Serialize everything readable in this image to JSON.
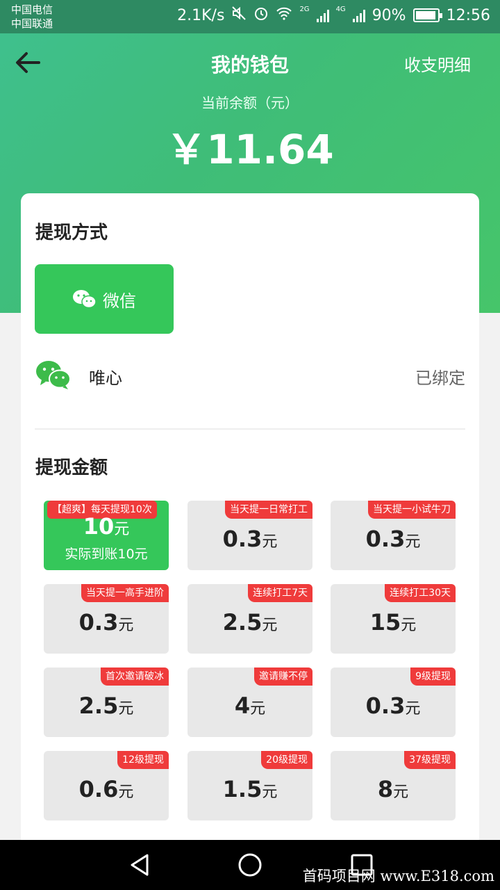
{
  "status_bar": {
    "carrier1": "中国电信",
    "carrier2": "中国联通",
    "speed": "2.1K/s",
    "net1": "2G",
    "net2": "4G",
    "battery": "90%",
    "time": "12:56"
  },
  "header": {
    "title": "我的钱包",
    "right_link": "收支明细",
    "balance_label": "当前余额（元）",
    "balance": "￥11.64"
  },
  "withdraw_method": {
    "title": "提现方式",
    "button_label": "微信",
    "account_name": "唯心",
    "bind_status": "已绑定"
  },
  "withdraw_amount": {
    "title": "提现金额",
    "unit": "元",
    "options": [
      {
        "tag": "【超爽】每天提现10次",
        "value": "10",
        "sub": "实际到账10元",
        "selected": true
      },
      {
        "tag": "当天提一日常打工",
        "value": "0.3"
      },
      {
        "tag": "当天提一小试牛刀",
        "value": "0.3"
      },
      {
        "tag": "当天提一高手进阶",
        "value": "0.3"
      },
      {
        "tag": "连续打工7天",
        "value": "2.5"
      },
      {
        "tag": "连续打工30天",
        "value": "15"
      },
      {
        "tag": "首次邀请破冰",
        "value": "2.5"
      },
      {
        "tag": "邀请赚不停",
        "value": "4"
      },
      {
        "tag": "9级提现",
        "value": "0.3"
      },
      {
        "tag": "12级提现",
        "value": "0.6"
      },
      {
        "tag": "20级提现",
        "value": "1.5"
      },
      {
        "tag": "37级提现",
        "value": "8"
      }
    ]
  },
  "watermark": "首码项目网 www.E318.com",
  "colors": {
    "header_green": "#3fc08f",
    "button_green": "#35c75a",
    "tag_red": "#ef3b3b",
    "option_gray": "#e8e8e8"
  }
}
